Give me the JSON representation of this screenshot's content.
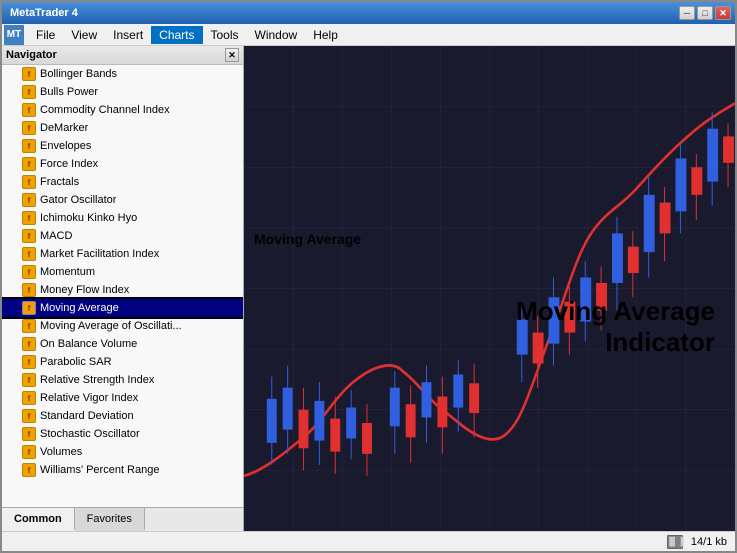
{
  "window": {
    "title": "MetaTrader 4",
    "buttons": {
      "minimize": "─",
      "maximize": "□",
      "close": "✕"
    }
  },
  "menubar": {
    "logo": "MT",
    "items": [
      {
        "label": "File",
        "id": "file"
      },
      {
        "label": "View",
        "id": "view"
      },
      {
        "label": "Insert",
        "id": "insert"
      },
      {
        "label": "Charts",
        "id": "charts",
        "active": true
      },
      {
        "label": "Tools",
        "id": "tools"
      },
      {
        "label": "Window",
        "id": "window"
      },
      {
        "label": "Help",
        "id": "help"
      }
    ]
  },
  "navigator": {
    "title": "Navigator",
    "indicators": [
      {
        "label": "Bollinger Bands",
        "id": "bollinger"
      },
      {
        "label": "Bulls Power",
        "id": "bulls"
      },
      {
        "label": "Commodity Channel Index",
        "id": "cci"
      },
      {
        "label": "DeMarker",
        "id": "demarker"
      },
      {
        "label": "Envelopes",
        "id": "envelopes"
      },
      {
        "label": "Force Index",
        "id": "force"
      },
      {
        "label": "Fractals",
        "id": "fractals"
      },
      {
        "label": "Gator Oscillator",
        "id": "gator"
      },
      {
        "label": "Ichimoku Kinko Hyo",
        "id": "ichimoku"
      },
      {
        "label": "MACD",
        "id": "macd"
      },
      {
        "label": "Market Facilitation Index",
        "id": "mfi"
      },
      {
        "label": "Momentum",
        "id": "momentum"
      },
      {
        "label": "Money Flow Index",
        "id": "moneyflow"
      },
      {
        "label": "Moving Average",
        "id": "ma",
        "selected": true
      },
      {
        "label": "Moving Average of Oscillati...",
        "id": "mao"
      },
      {
        "label": "On Balance Volume",
        "id": "obv"
      },
      {
        "label": "Parabolic SAR",
        "id": "parabolic"
      },
      {
        "label": "Relative Strength Index",
        "id": "rsi"
      },
      {
        "label": "Relative Vigor Index",
        "id": "rvi"
      },
      {
        "label": "Standard Deviation",
        "id": "stddev"
      },
      {
        "label": "Stochastic Oscillator",
        "id": "stochastic"
      },
      {
        "label": "Volumes",
        "id": "volumes"
      },
      {
        "label": "Williams' Percent Range",
        "id": "williams"
      }
    ],
    "tabs": [
      {
        "label": "Common",
        "active": true
      },
      {
        "label": "Favorites"
      }
    ]
  },
  "chart": {
    "moving_average_label": "Moving Average",
    "main_label_line1": "Moving Average",
    "main_label_line2": "Indicator"
  },
  "statusbar": {
    "file_info": "14/1 kb"
  }
}
